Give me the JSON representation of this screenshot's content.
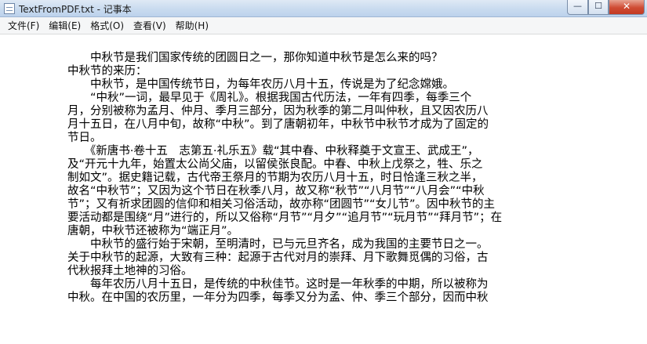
{
  "window": {
    "title": "TextFromPDF.txt - 记事本",
    "minimize_label": "—",
    "maximize_label": "☐",
    "close_label": "✕"
  },
  "menu": [
    {
      "label": "文件(F)"
    },
    {
      "label": "编辑(E)"
    },
    {
      "label": "格式(O)"
    },
    {
      "label": "查看(V)"
    },
    {
      "label": "帮助(H)"
    }
  ],
  "document": {
    "lines": [
      "　　中秋节是我们国家传统的团圆日之一，那你知道中秋节是怎么来的吗？",
      "中秋节的来历：",
      "　　中秋节，是中国传统节日，为每年农历八月十五，传说是为了纪念嫦娥。",
      "　　“中秋”一词，最早见于《周礼》。根据我国古代历法，一年有四季，每季三个",
      "月，分别被称为孟月、仲月、季月三部分，因为秋季的第二月叫仲秋，且又因农历八",
      "月十五日，在八月中旬，故称“中秋”。到了唐朝初年，中秋节中秋节才成为了固定的",
      "节日。",
      "　　《新唐书·卷十五　志第五·礼乐五》载“其中春、中秋释奠于文宣王、武成王”，",
      "及“开元十九年，始置太公尚父庙，以留侯张良配。中春、中秋上戊祭之，牲、乐之",
      "制如文”。据史籍记载，古代帝王祭月的节期为农历八月十五，时日恰逢三秋之半，",
      "故名“中秋节”；又因为这个节日在秋季八月，故又称“秋节”“八月节”“八月会”“中秋",
      "节”；又有祈求团圆的信仰和相关习俗活动，故亦称“团圆节”“女儿节”。因中秋节的主",
      "要活动都是围绕“月”进行的，所以又俗称“月节”“月夕”“追月节”“玩月节”“拜月节”；在",
      "唐朝，中秋节还被称为“端正月”。",
      "　　中秋节的盛行始于宋朝，至明清时，已与元旦齐名，成为我国的主要节日之一。",
      "关于中秋节的起源，大致有三种：起源于古代对月的崇拜、月下歌舞觅偶的习俗，古",
      "代秋报拜土地神的习俗。",
      "　　每年农历八月十五日，是传统的中秋佳节。这时是一年秋季的中期，所以被称为",
      "中秋。在中国的农历里，一年分为四季，每季又分为孟、仲、季三个部分，因而中秋"
    ]
  }
}
